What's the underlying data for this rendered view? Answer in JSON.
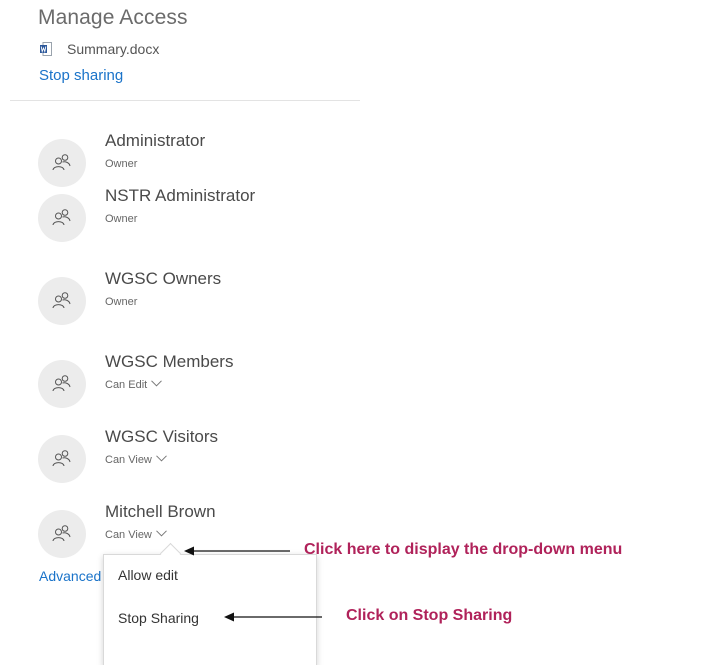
{
  "panel": {
    "title": "Manage Access",
    "file_icon": "word-document-icon",
    "file_name": "Summary.docx",
    "stop_sharing_link": "Stop sharing"
  },
  "people": [
    {
      "name": "Administrator",
      "role": "Owner",
      "has_dropdown": false
    },
    {
      "name": "NSTR Administrator",
      "role": "Owner",
      "has_dropdown": false
    },
    {
      "name": "WGSC Owners",
      "role": "Owner",
      "has_dropdown": false
    },
    {
      "name": "WGSC Members",
      "role": "Can Edit",
      "has_dropdown": true
    },
    {
      "name": "WGSC Visitors",
      "role": "Can View",
      "has_dropdown": true
    },
    {
      "name": "Mitchell Brown",
      "role": "Can View",
      "has_dropdown": true
    }
  ],
  "advanced_link": "Advanced",
  "dropdown_menu": {
    "items": [
      "Allow edit",
      "Stop Sharing"
    ]
  },
  "annotations": {
    "dropdown_hint": "Click here to display the drop-down menu",
    "stop_sharing_hint": "Click on Stop Sharing"
  },
  "colors": {
    "link": "#1a73c9",
    "annotation": "#b0225a",
    "avatar_bg": "#ececec"
  }
}
